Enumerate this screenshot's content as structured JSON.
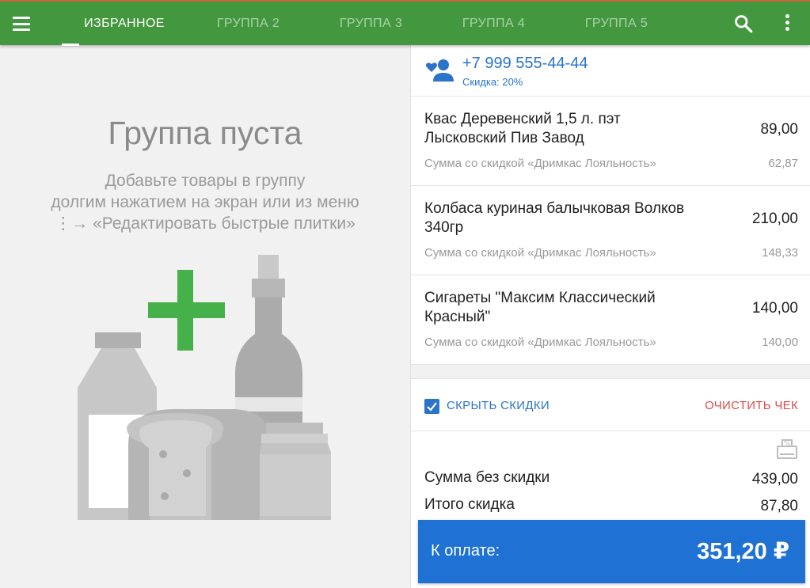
{
  "tabs": [
    {
      "label": "ИЗБРАННОЕ",
      "active": true
    },
    {
      "label": "ГРУППА 2",
      "active": false
    },
    {
      "label": "ГРУППА 3",
      "active": false
    },
    {
      "label": "ГРУППА 4",
      "active": false
    },
    {
      "label": "ГРУППА 5",
      "active": false
    }
  ],
  "icons": {
    "menu": "menu-icon",
    "search": "search-icon",
    "more": "more-vert-icon",
    "client": "loyal-client-icon",
    "receipt": "discount-receipt-icon"
  },
  "empty_group": {
    "title": "Группа пуста",
    "hint_line1": "Добавьте товары в группу",
    "hint_line2": "долгим нажатием на экран или из меню",
    "hint_line3": "⋮→ «Редактировать быстрые плитки»"
  },
  "client": {
    "phone": "+7 999 555-44-44",
    "discount": "Скидка: 20%"
  },
  "items": [
    {
      "name": "Квас Деревенский 1,5 л. пэт Лысковский Пив Завод",
      "price": "89,00",
      "discount_label": "Сумма со скидкой «Дримкас Лояльность»",
      "discount_value": "62,87"
    },
    {
      "name": "Колбаса куриная балычковая Волков 340гр",
      "price": "210,00",
      "discount_label": "Сумма со скидкой «Дримкас Лояльность»",
      "discount_value": "148,33"
    },
    {
      "name": "Сигареты \"Максим Классический Красный\"",
      "price": "140,00",
      "discount_label": "Сумма со скидкой «Дримкас Лояльность»",
      "discount_value": "140,00"
    }
  ],
  "actions": {
    "hide_discounts_label": "СКРЫТЬ СКИДКИ",
    "hide_discounts_checked": true,
    "clear_label": "ОЧИСТИТЬ ЧЕК"
  },
  "totals": {
    "sum_label": "Сумма без скидки",
    "sum_value": "439,00",
    "discount_label": "Итого скидка",
    "discount_value": "87,80",
    "pay_label": "К оплате:",
    "pay_value": "351,20 ₽"
  },
  "colors": {
    "topbar": "#43983f",
    "accent_blue": "#2a74c9",
    "pay_button": "#1f72d3",
    "clear_red": "#e04b4b",
    "plus_green": "#46b04a"
  }
}
